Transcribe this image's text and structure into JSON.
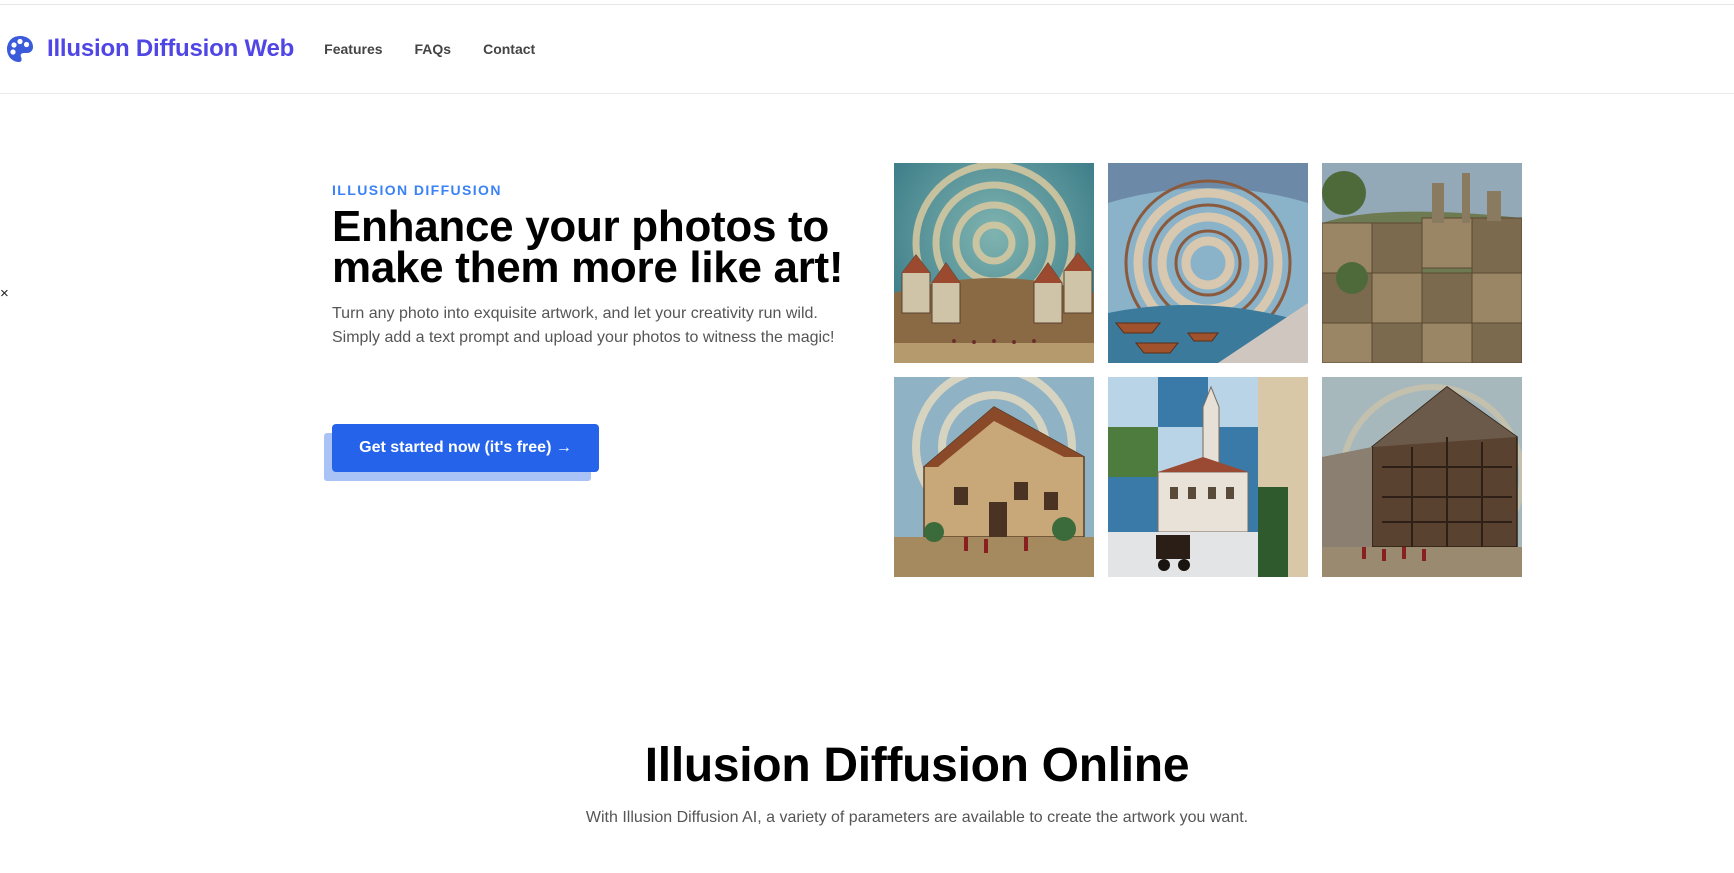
{
  "header": {
    "brand": "Illusion Diffusion Web",
    "logo_icon": "palette-icon",
    "nav": [
      {
        "label": "Features"
      },
      {
        "label": "FAQs"
      },
      {
        "label": "Contact"
      }
    ]
  },
  "side_control": {
    "glyph": "×",
    "icon": "close-icon"
  },
  "hero": {
    "eyebrow": "ILLUSION DIFFUSION",
    "title_line1": "Enhance your photos to",
    "title_line2": "make them more like art!",
    "description": "Turn any photo into exquisite artwork, and let your creativity run wild. Simply add a text prompt and upload your photos to witness the magic!",
    "cta_label": "Get started now (it's free) →"
  },
  "gallery": [
    {
      "name": "spiral-village-image"
    },
    {
      "name": "spiral-canal-image"
    },
    {
      "name": "checkered-castle-image"
    },
    {
      "name": "spiral-cottage-image"
    },
    {
      "name": "checkered-church-image"
    },
    {
      "name": "spiral-timber-house-image"
    }
  ],
  "section": {
    "title": "Illusion Diffusion Online",
    "description": "With Illusion Diffusion AI, a variety of parameters are available to create the artwork you want."
  },
  "colors": {
    "brand": "#4f46e5",
    "accent": "#3b82f6",
    "button": "#2563eb"
  }
}
